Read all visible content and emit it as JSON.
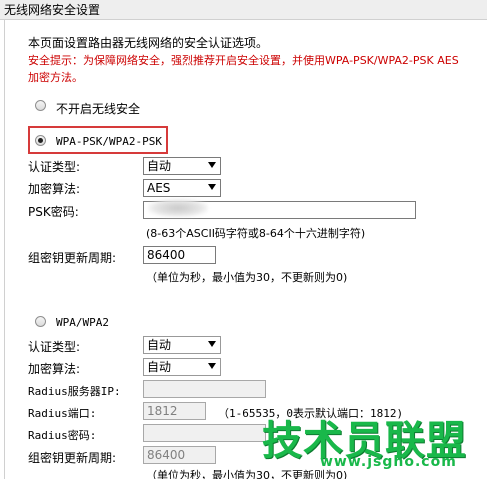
{
  "title": "无线网络安全设置",
  "intro": "本页面设置路由器无线网络的安全认证选项。",
  "warning_line1": "安全提示：为保障网络安全，强烈推荐开启安全设置，并使用WPA-PSK/WPA2-PSK AES",
  "warning_line2": "加密方法。",
  "options": {
    "no_security": "不开启无线安全",
    "wpa_psk": "WPA-PSK/WPA2-PSK",
    "wpa": "WPA/WPA2"
  },
  "psk": {
    "auth_type_label": "认证类型:",
    "auth_type_value": "自动",
    "encryption_label": "加密算法:",
    "encryption_value": "AES",
    "password_label": "PSK密码:",
    "password_value": "",
    "password_hint": "(8-63个ASCII码字符或8-64个十六进制字符)",
    "renewal_label": "组密钥更新周期:",
    "renewal_value": "86400",
    "renewal_hint": "（单位为秒，最小值为30，不更新则为0)"
  },
  "wpa": {
    "auth_type_label": "认证类型:",
    "auth_type_value": "自动",
    "encryption_label": "加密算法:",
    "encryption_value": "自动",
    "radius_ip_label": "Radius服务器IP:",
    "radius_ip_value": "",
    "radius_port_label": "Radius端口:",
    "radius_port_value": "1812",
    "radius_port_hint": "（1-65535，0表示默认端口：1812)",
    "radius_password_label": "Radius密码:",
    "radius_password_value": "",
    "renewal_label": "组密钥更新周期:",
    "renewal_value": "86400",
    "renewal_hint": "（单位为秒，最小值为30，不更新则为0)"
  },
  "watermark": {
    "text": "技术员联盟",
    "url": "www.jsgho.com"
  },
  "colors": {
    "warning": "#cc0000",
    "highlight_border": "#d63a3a",
    "watermark": "#19b84a"
  }
}
